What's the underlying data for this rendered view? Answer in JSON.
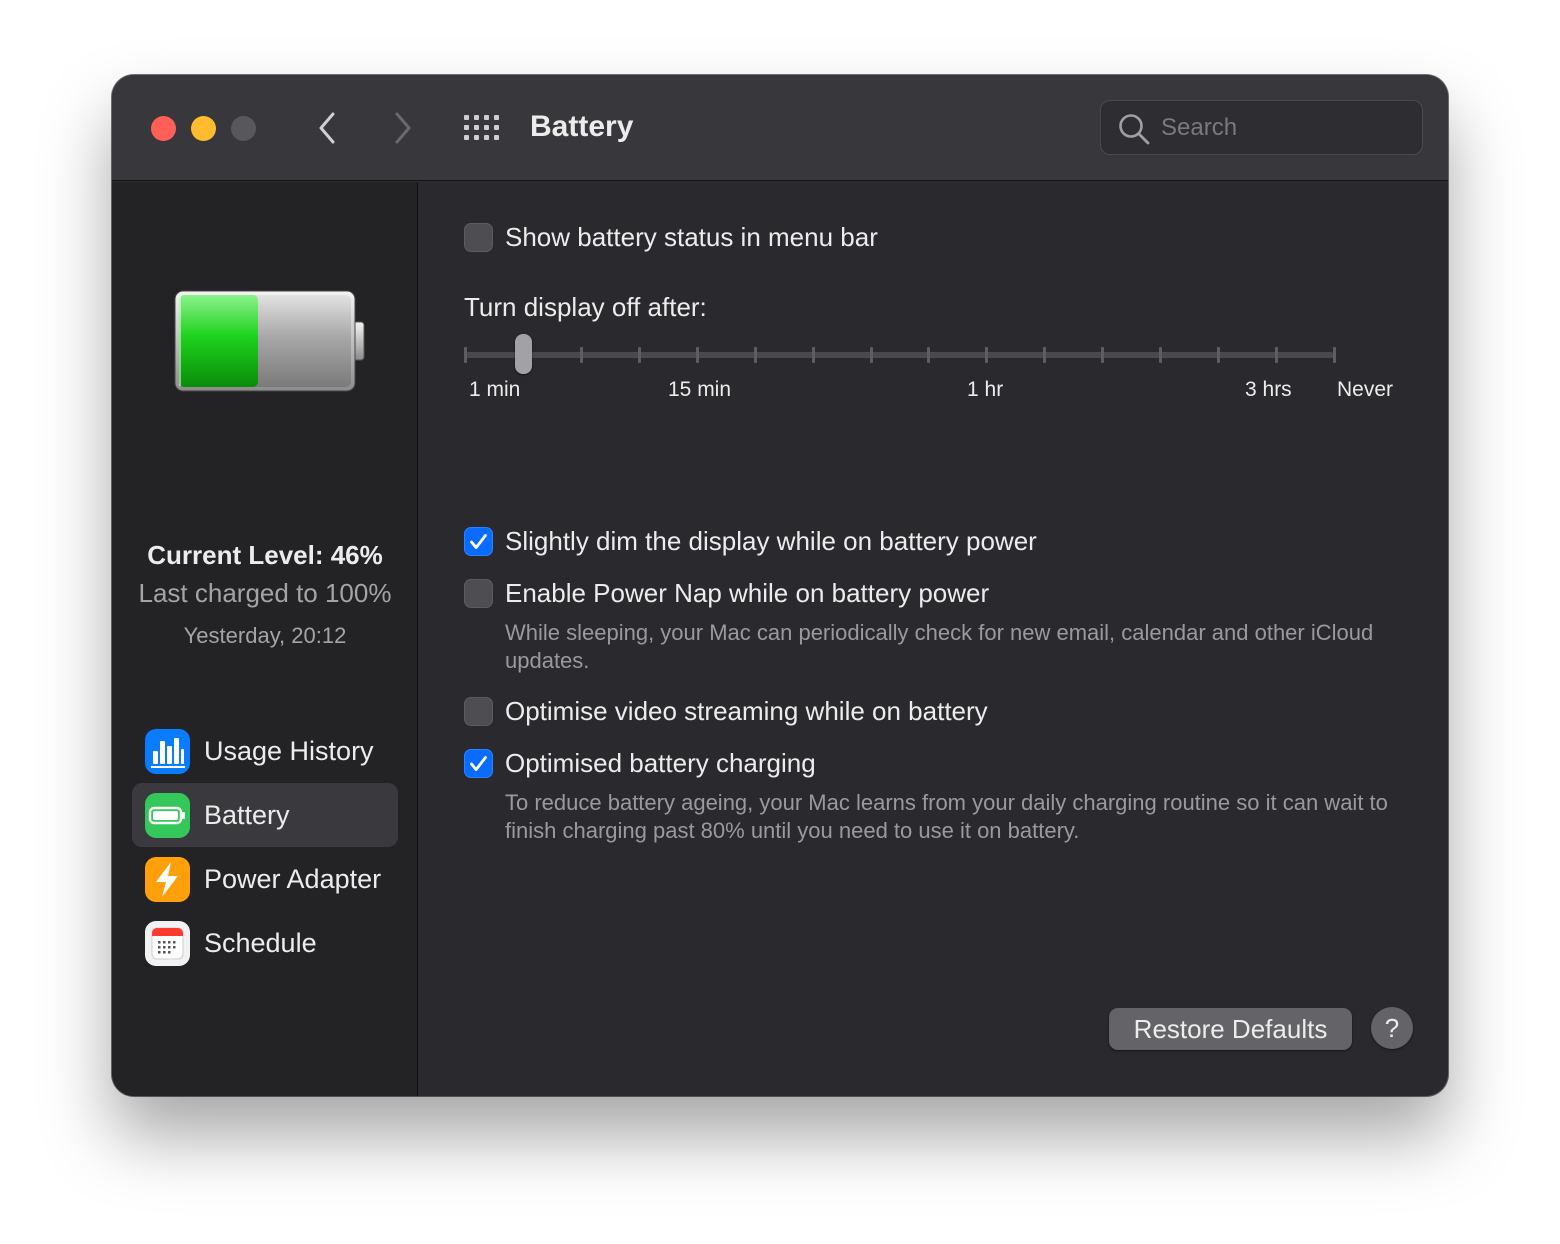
{
  "window": {
    "title": "Battery",
    "traffic_lights": {
      "close": "#ff5f57",
      "minimize": "#febc2e",
      "zoom": "#58585c"
    },
    "nav": {
      "back_icon": "chevron-left-icon",
      "forward_icon": "chevron-right-icon",
      "grid_icon": "show-all-grid-icon"
    },
    "search": {
      "placeholder": "Search",
      "value": "",
      "icon": "search-icon"
    }
  },
  "sidebar": {
    "battery_level_fraction": 0.46,
    "current_level": "Current Level: 46%",
    "last_charged": "Last charged to 100%",
    "charged_time": "Yesterday, 20:12",
    "items": [
      {
        "label": "Usage History",
        "icon": "usage-history-bar-chart-icon",
        "color": "#0a7cff",
        "selected": false
      },
      {
        "label": "Battery",
        "icon": "battery-icon",
        "color": "#34c759",
        "selected": true
      },
      {
        "label": "Power Adapter",
        "icon": "lightning-bolt-icon",
        "color": "#ff9f0a",
        "selected": false
      },
      {
        "label": "Schedule",
        "icon": "calendar-icon",
        "color": "#f2f2f2",
        "selected": false
      }
    ]
  },
  "main": {
    "options": [
      {
        "label": "Show battery status in menu bar",
        "checked": false
      },
      {
        "label": "Slightly dim the display while on battery power",
        "checked": true
      },
      {
        "label": "Enable Power Nap while on battery power",
        "checked": false,
        "description": "While sleeping, your Mac can periodically check for new email, calendar and other iCloud updates."
      },
      {
        "label": "Optimise video streaming while on battery",
        "checked": false
      },
      {
        "label": "Optimised battery charging",
        "checked": true,
        "description": "To reduce battery ageing, your Mac learns from your daily charging routine so it can wait to finish charging past 80% until you need to use it on battery."
      }
    ],
    "display_slider": {
      "title": "Turn display off after:",
      "tick_count": 16,
      "selected_step": 1,
      "labels": [
        "1 min",
        "15 min",
        "1 hr",
        "3 hrs",
        "Never"
      ]
    },
    "restore_defaults": "Restore Defaults",
    "help": "?"
  },
  "colors": {
    "accent": "#0a6cff",
    "window_bg": "#2a2a2e",
    "sidebar_bg": "#232326",
    "titlebar_bg": "#38383c"
  }
}
